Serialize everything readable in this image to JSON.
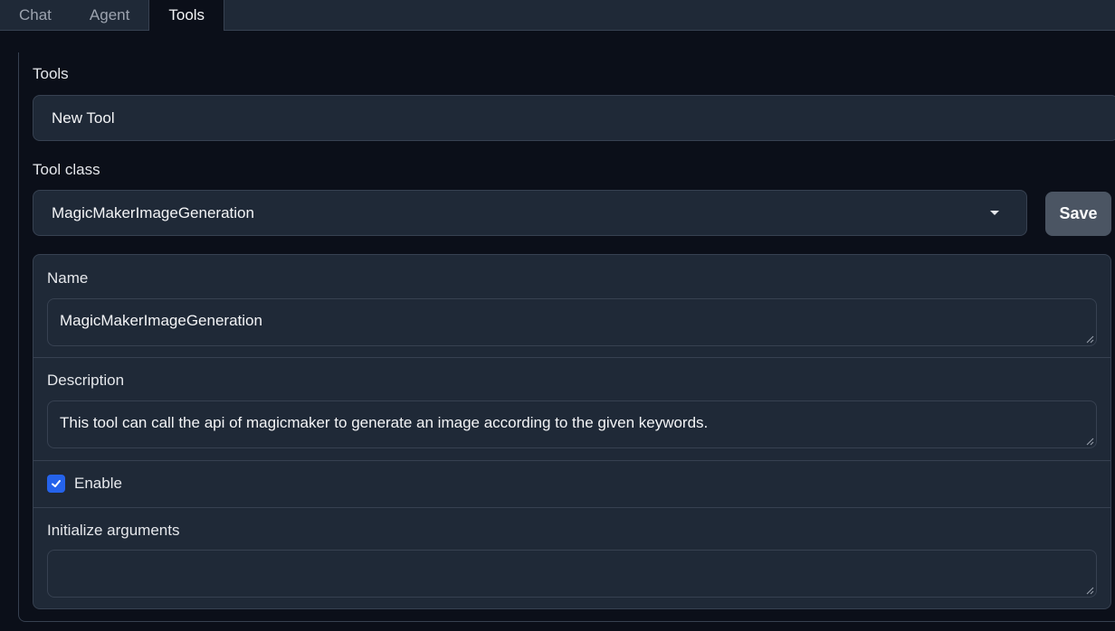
{
  "tabs": [
    {
      "label": "Chat",
      "active": false
    },
    {
      "label": "Agent",
      "active": false
    },
    {
      "label": "Tools",
      "active": true
    }
  ],
  "tools": {
    "label": "Tools",
    "value": "New Tool"
  },
  "tool_class": {
    "label": "Tool class",
    "selected": "MagicMakerImageGeneration"
  },
  "save_label": "Save",
  "name": {
    "label": "Name",
    "value": "MagicMakerImageGeneration"
  },
  "description": {
    "label": "Description",
    "value": "This tool can call the api of magicmaker to generate an image according to the given keywords."
  },
  "enable": {
    "label": "Enable",
    "checked": true
  },
  "init_args": {
    "label": "Initialize arguments",
    "value": ""
  },
  "colors": {
    "accent": "#2563eb",
    "background": "#0b0f19",
    "surface": "#1f2937",
    "border": "#374151"
  }
}
